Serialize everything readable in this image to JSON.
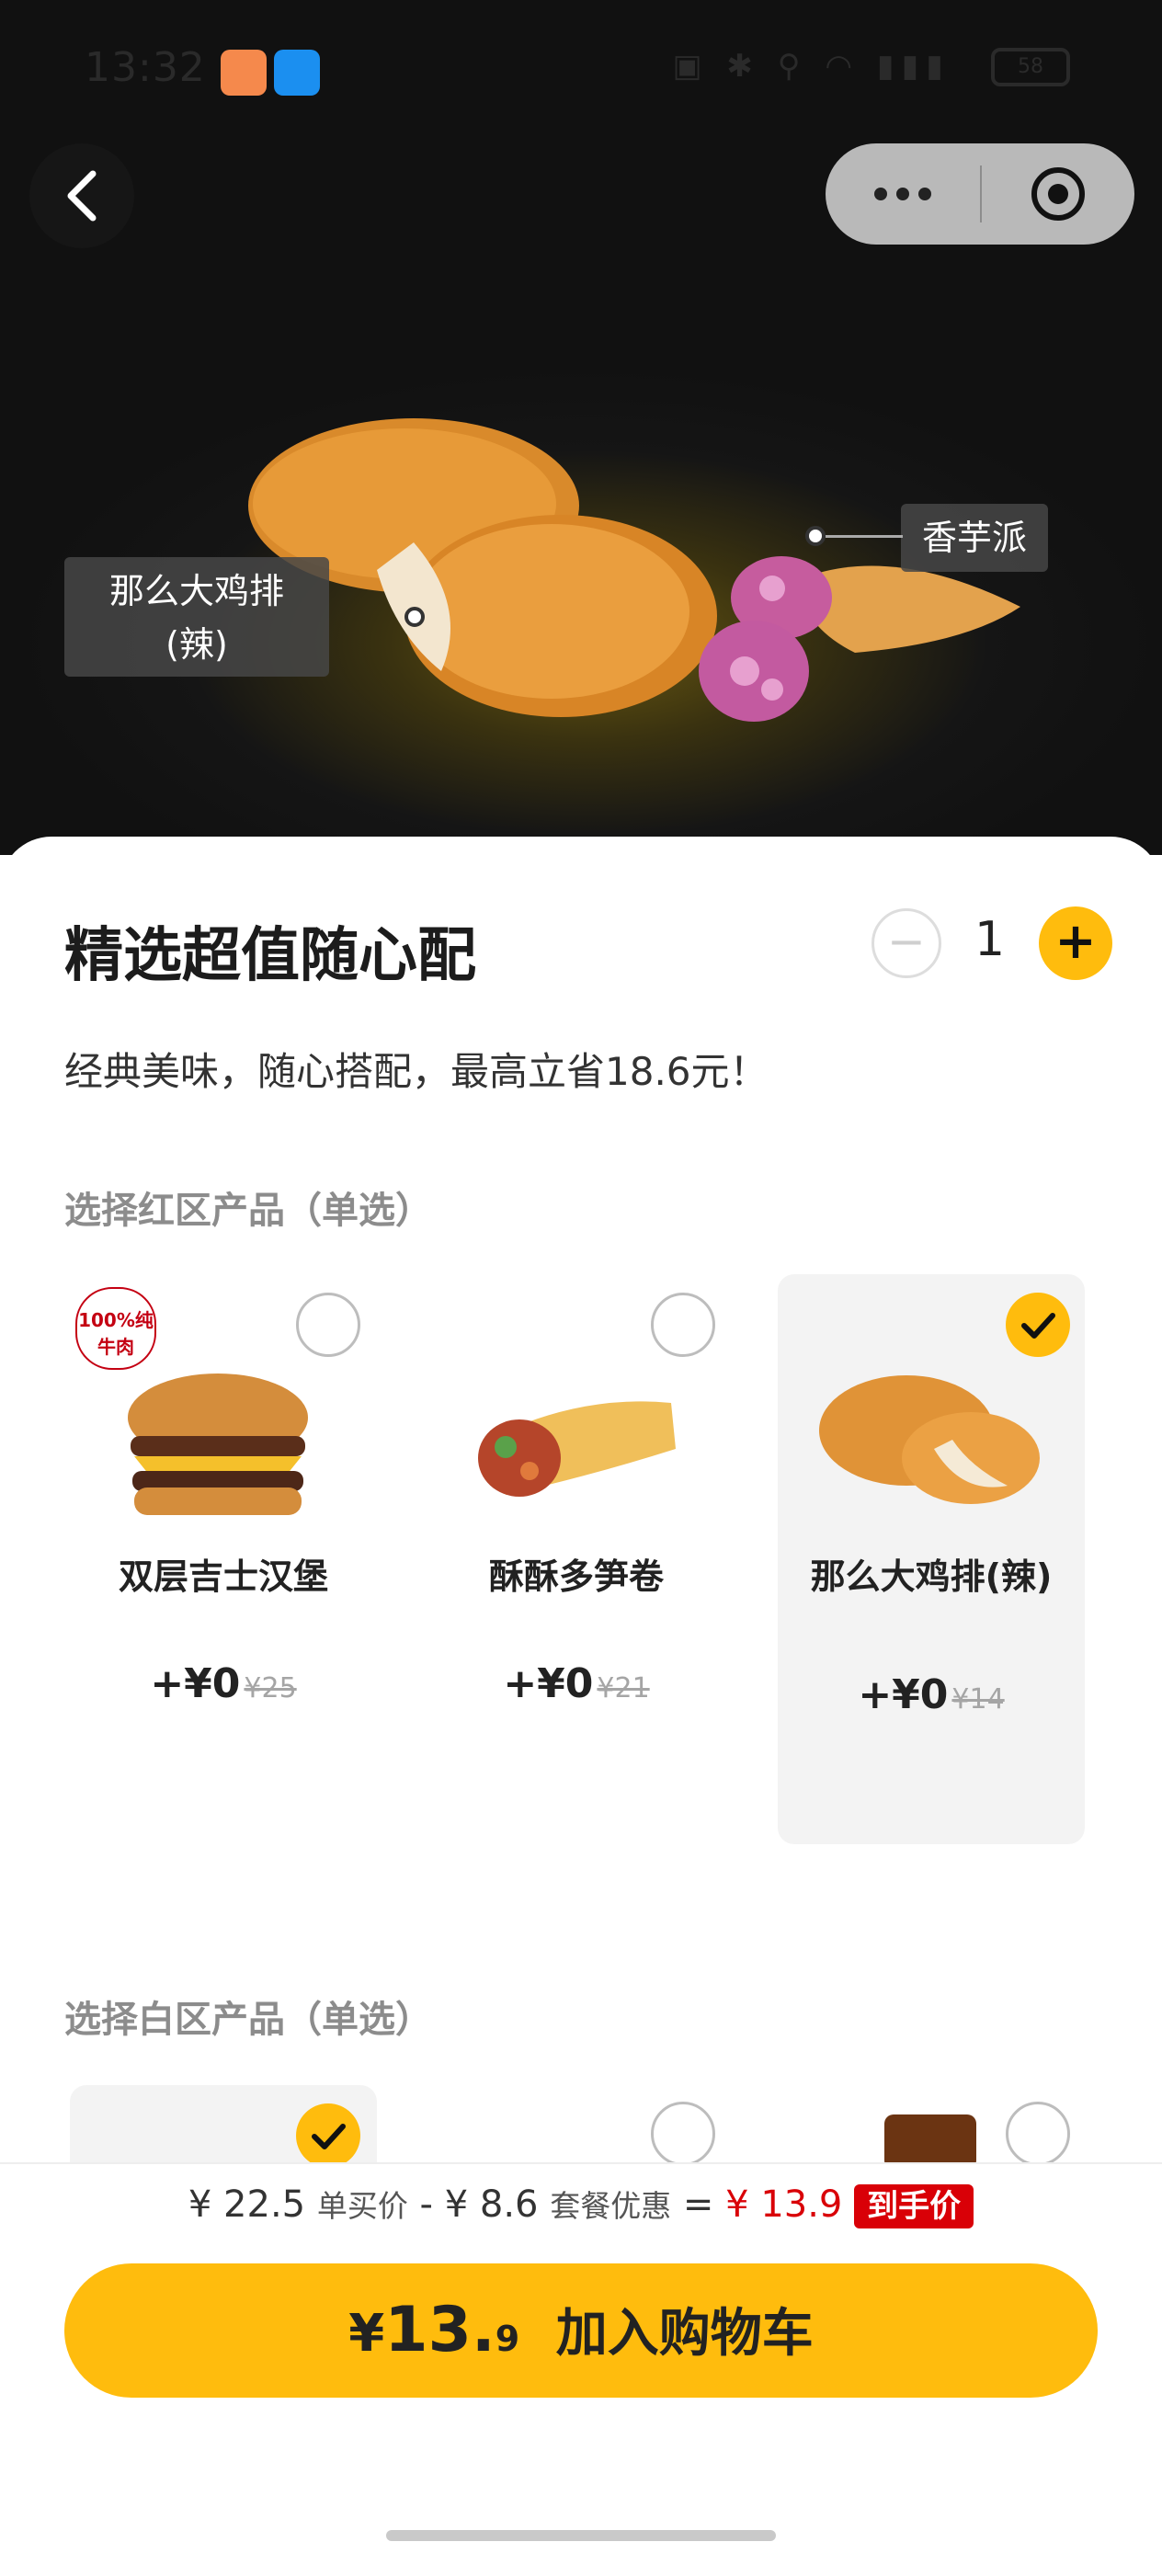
{
  "status_bar": {
    "time": "13:32",
    "battery": "58"
  },
  "hero": {
    "labels": [
      "那么大鸡排\n(辣)",
      "香芋派"
    ]
  },
  "product": {
    "title": "精选超值随心配",
    "quantity": "1",
    "minus_label": "−",
    "plus_label": "+",
    "description": "经典美味，随心搭配，最高立省18.6元！"
  },
  "red_zone": {
    "label": "选择红区产品（单选）",
    "badge": "100%纯牛肉",
    "items": [
      {
        "name": "双层吉士汉堡",
        "price": "+¥0",
        "original": "¥25",
        "selected": false
      },
      {
        "name": "酥酥多笋卷",
        "price": "+¥0",
        "original": "¥21",
        "selected": false
      },
      {
        "name": "那么大鸡排(辣)",
        "price": "+¥0",
        "original": "¥14",
        "selected": true
      }
    ]
  },
  "white_zone": {
    "label": "选择白区产品（单选）",
    "selected_index": 0
  },
  "summary": {
    "single_price": "¥ 22.5",
    "single_label": "单买价",
    "minus": "-",
    "discount": "¥ 8.6",
    "discount_label": "套餐优惠",
    "equals": "=",
    "final": "¥ 13.9",
    "final_badge": "到手价"
  },
  "cta": {
    "currency": "¥",
    "price_int": "13.",
    "price_dec": "9",
    "label": "加入购物车"
  },
  "colors": {
    "accent": "#ffbc0d",
    "red": "#d90007"
  }
}
